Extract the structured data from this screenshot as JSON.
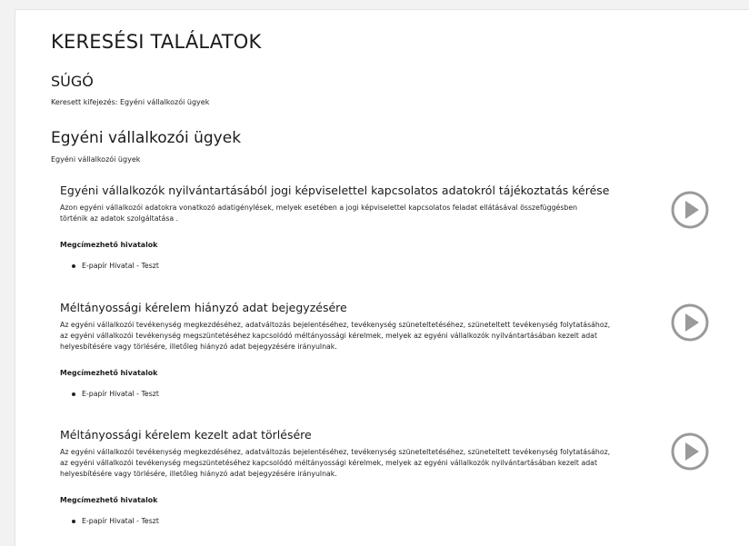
{
  "page": {
    "title": "KERESÉSI TALÁLATOK",
    "help_title": "SÚGÓ",
    "search_term": "Keresett kifejezés: Egyéni vállalkozói ügyek"
  },
  "category": {
    "title": "Egyéni vállalkozói ügyek",
    "subtitle": "Egyéni vállalkozói ügyek"
  },
  "results": [
    {
      "title": "Egyéni vállalkozók nyilvántartásából jogi képviselettel kapcsolatos adatokról tájékoztatás kérése",
      "description": "Azon egyéni vállalkozói adatokra vonatkozó adatigénylések, melyek esetében a jogi képviselettel kapcsolatos feladat ellátásával összefüggésben történik az adatok szolgáltatása .",
      "offices_heading": "Megcímezhető hivatalok",
      "offices": [
        "E-papír Hivatal - Teszt"
      ]
    },
    {
      "title": "Méltányossági kérelem hiányzó adat bejegyzésére",
      "description": "Az egyéni vállalkozói tevékenység megkezdéséhez, adatváltozás bejelentéséhez, tevékenység szüneteltetéséhez, szüneteltett tevékenység folytatásához, az egyéni vállalkozói tevékenység megszüntetéséhez kapcsolódó méltányossági kérelmek, melyek az egyéni vállalkozók nyilvántartásában kezelt adat helyesbítésére vagy törlésére, illetőleg hiányzó adat bejegyzésére irányulnak.",
      "offices_heading": "Megcímezhető hivatalok",
      "offices": [
        "E-papír Hivatal - Teszt"
      ]
    },
    {
      "title": "Méltányossági kérelem kezelt adat törlésére",
      "description": "Az egyéni vállalkozói tevékenység megkezdéséhez, adatváltozás bejelentéséhez, tevékenység szüneteltetéséhez, szüneteltett tevékenység folytatásához, az egyéni vállalkozói tevékenység megszüntetéséhez kapcsolódó méltányossági kérelmek, melyek az egyéni vállalkozók nyilvántartásában kezelt adat helyesbítésére vagy törlésére, illetőleg hiányzó adat bejegyzésére irányulnak.",
      "offices_heading": "Megcímezhető hivatalok",
      "offices": [
        "E-papír Hivatal - Teszt"
      ]
    }
  ],
  "icons": {
    "play": "play-circle-icon"
  },
  "colors": {
    "play_icon": "#9a9a9a",
    "background": "#f2f2f2",
    "panel": "#ffffff"
  }
}
